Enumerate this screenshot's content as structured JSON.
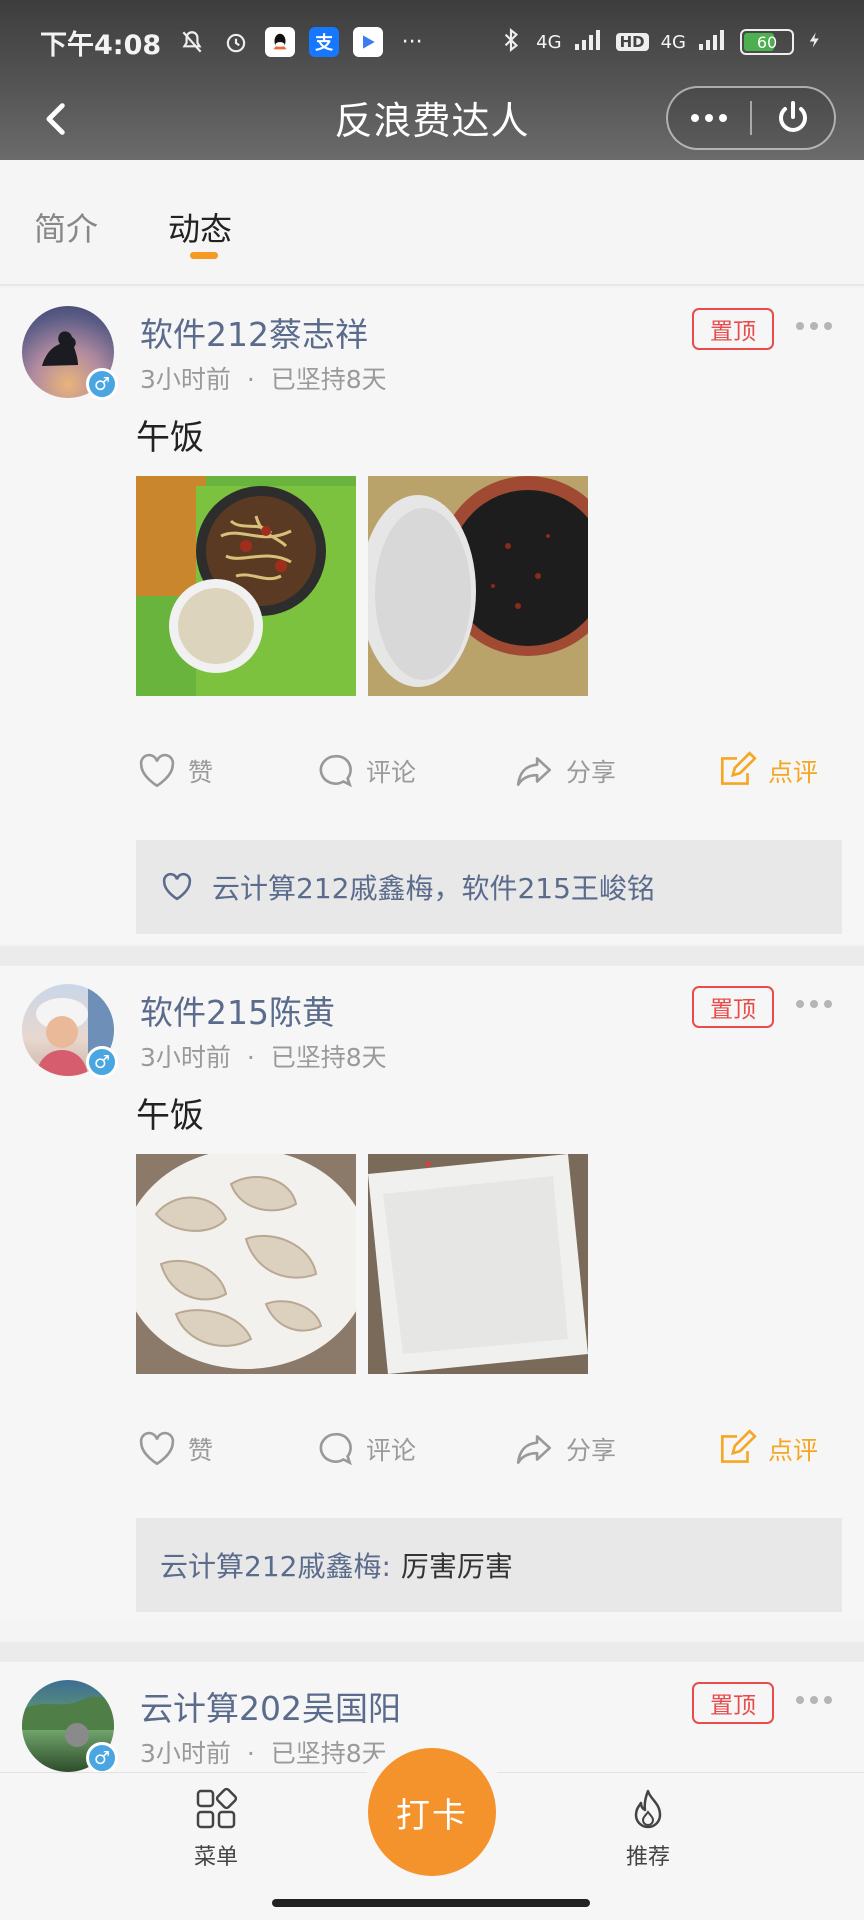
{
  "status_bar": {
    "time": "下午4:08",
    "net_label_1": "4G",
    "hd_label": "HD",
    "net_label_2": "4G",
    "battery": "60",
    "more_label": "···"
  },
  "nav": {
    "title": "反浪费达人"
  },
  "tabs": [
    {
      "label": "简介"
    },
    {
      "label": "动态"
    }
  ],
  "posts": [
    {
      "author": "软件212蔡志祥",
      "time": "3小时前",
      "streak": "已坚持8天",
      "pin_label": "置顶",
      "text": "午饭",
      "likes_text": "云计算212戚鑫梅，软件215王峻铭"
    },
    {
      "author": "软件215陈黄",
      "time": "3小时前",
      "streak": "已坚持8天",
      "pin_label": "置顶",
      "text": "午饭",
      "comment_author": "云计算212戚鑫梅:",
      "comment_text": "厉害厉害"
    },
    {
      "author": "云计算202吴国阳",
      "time": "3小时前",
      "streak": "已坚持8天",
      "pin_label": "置顶"
    }
  ],
  "actions": {
    "like": "赞",
    "comment": "评论",
    "share": "分享",
    "review": "点评"
  },
  "meta_separator": "·",
  "bottom_nav": {
    "menu": "菜单",
    "checkin": "打卡",
    "recommend": "推荐"
  },
  "colors": {
    "accent": "#f4922b",
    "pin": "#e94b4b",
    "username": "#5a6b8c",
    "review": "#f5a623"
  }
}
